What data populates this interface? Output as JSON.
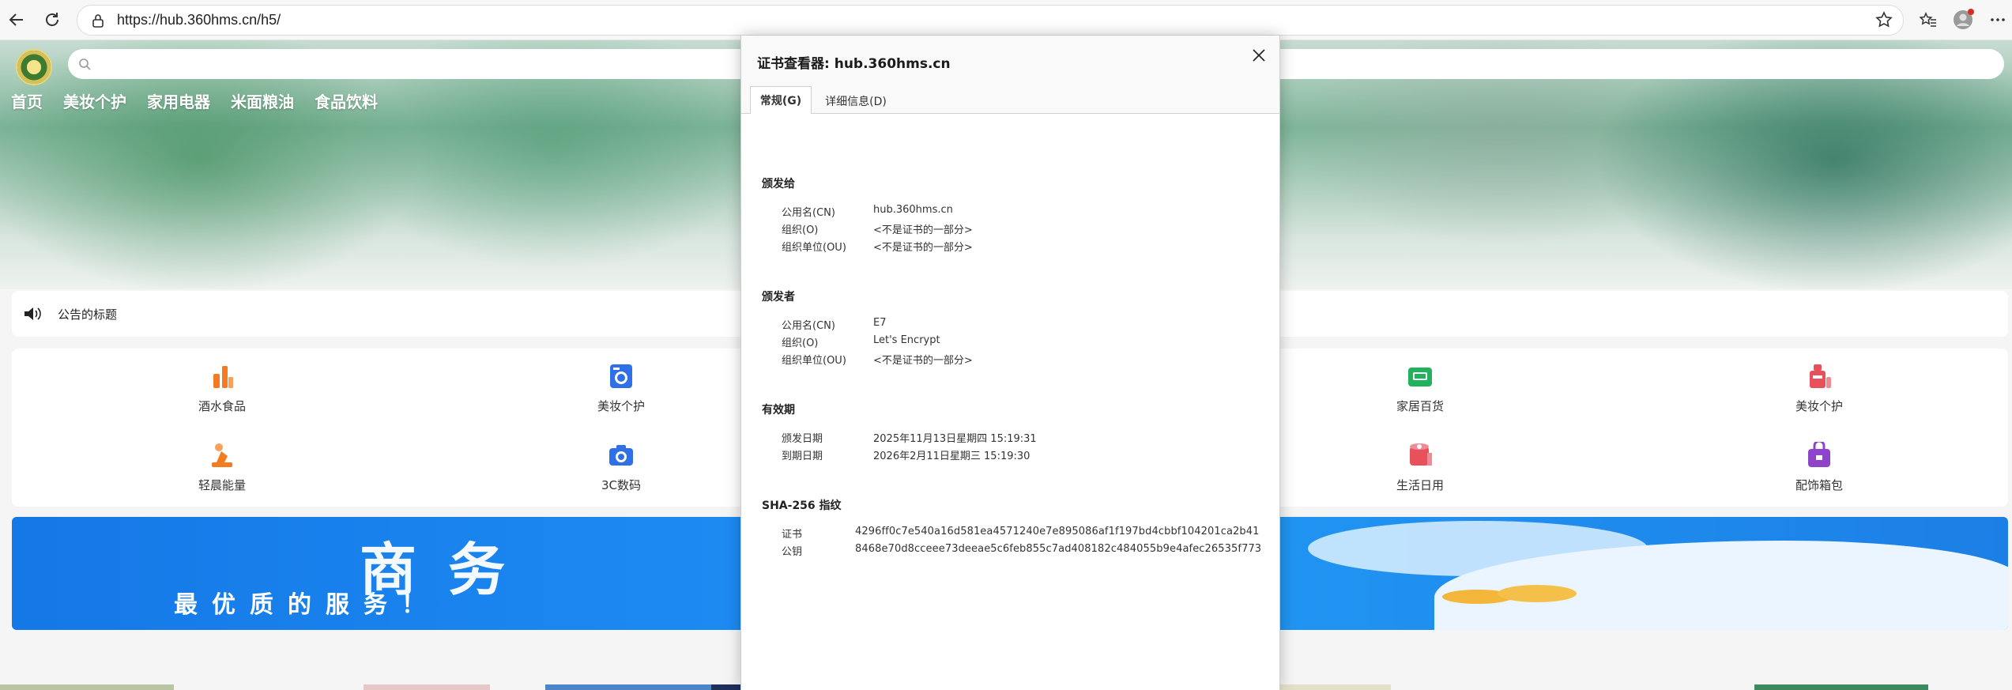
{
  "browser": {
    "url": "https://hub.360hms.cn/h5/"
  },
  "site": {
    "nav": [
      "首页",
      "美妆个护",
      "家用电器",
      "米面粮油",
      "食品饮料"
    ],
    "notice": "公告的标题",
    "categories": [
      {
        "label": "酒水食品",
        "color": "#f47b20",
        "icon": "wine-bottle-icon"
      },
      {
        "label": "美妆个护",
        "color": "#2f6fe8",
        "icon": "washing-machine-icon"
      },
      {
        "label": "家居百货",
        "color": "#22b25e",
        "icon": "sofa-icon"
      },
      {
        "label": "美妆个护",
        "color": "#e8505b",
        "icon": "cosmetics-icon"
      },
      {
        "label": "轻晨能量",
        "color": "#f47b20",
        "icon": "fitness-icon"
      },
      {
        "label": "3C数码",
        "color": "#2f6fe8",
        "icon": "camera-icon"
      },
      {
        "label": "生活日用",
        "color": "#e8505b",
        "icon": "tissue-roll-icon"
      },
      {
        "label": "配饰箱包",
        "color": "#8e44c9",
        "icon": "bag-icon"
      }
    ],
    "banner": {
      "headline": "商务",
      "slogan": "最优质的服务！"
    }
  },
  "dialog": {
    "title": "证书查看器: hub.360hms.cn",
    "tabs": [
      "常规(G)",
      "详细信息(D)"
    ],
    "issued_to": {
      "heading": "颁发给",
      "rows": [
        {
          "k": "公用名(CN)",
          "v": "hub.360hms.cn"
        },
        {
          "k": "组织(O)",
          "v": "<不是证书的一部分>"
        },
        {
          "k": "组织单位(OU)",
          "v": "<不是证书的一部分>"
        }
      ]
    },
    "issued_by": {
      "heading": "颁发者",
      "rows": [
        {
          "k": "公用名(CN)",
          "v": "E7"
        },
        {
          "k": "组织(O)",
          "v": "Let's Encrypt"
        },
        {
          "k": "组织单位(OU)",
          "v": "<不是证书的一部分>"
        }
      ]
    },
    "validity": {
      "heading": "有效期",
      "rows": [
        {
          "k": "颁发日期",
          "v": "2025年11月13日星期四 15:19:31"
        },
        {
          "k": "到期日期",
          "v": "2026年2月11日星期三 15:19:30"
        }
      ]
    },
    "fingerprints": {
      "heading": "SHA-256 指纹",
      "rows": [
        {
          "k": "证书",
          "v": "4296ff0c7e540a16d581ea4571240e7e895086af1f197bd4cbbf104201ca2b41"
        },
        {
          "k": "公钥",
          "v": "8468e70d8cceee73deeae5c6feb855c7ad408182c484055b9e4afec26535f773"
        }
      ]
    }
  }
}
